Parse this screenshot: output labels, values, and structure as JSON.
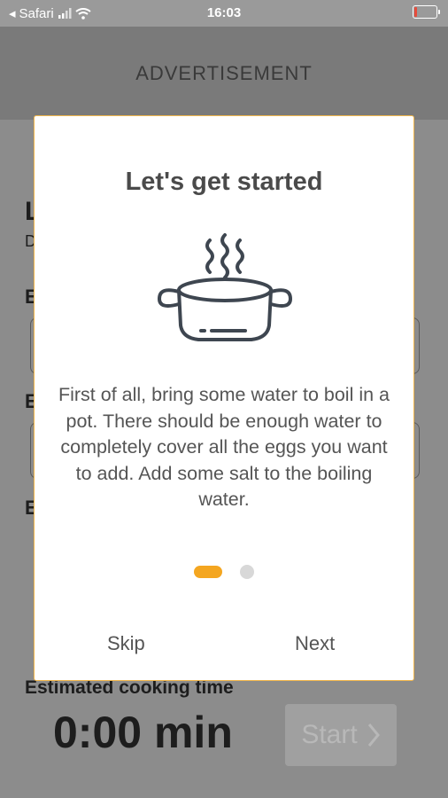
{
  "status_bar": {
    "carrier": "Safari",
    "time": "16:03",
    "battery_level": 0.15
  },
  "ad": {
    "label": "ADVERTISEMENT"
  },
  "background": {
    "estimated_label": "Estimated cooking time",
    "timer": "0:00 min",
    "start_label": "Start",
    "letters": [
      "L",
      "D",
      "E",
      "E",
      "E"
    ]
  },
  "modal": {
    "title": "Let's get started",
    "body": "First of all, bring some water to boil in a pot. There should be enough water to completely cover all the eggs you want to add. Add some salt to the boiling water.",
    "skip_label": "Skip",
    "next_label": "Next",
    "icon": "steaming-pot-icon",
    "page_index": 1,
    "page_count": 2,
    "accent_color": "#f4a620"
  }
}
